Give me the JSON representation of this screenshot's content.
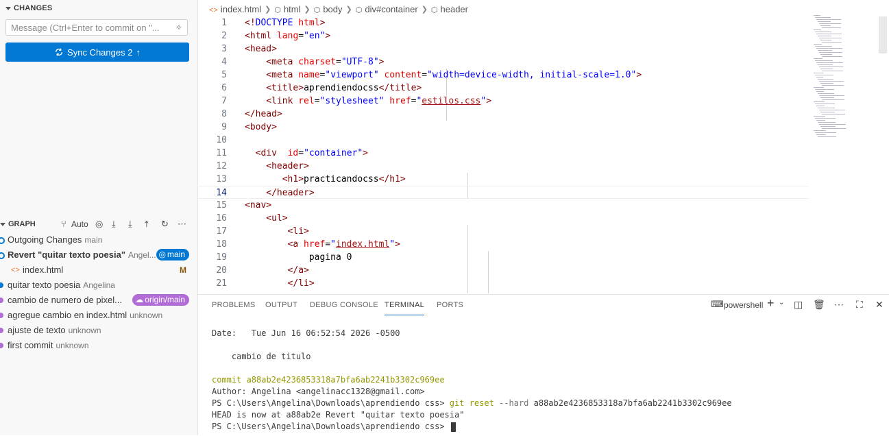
{
  "scm": {
    "changes_title": "CHANGES",
    "message_placeholder": "Message (Ctrl+Enter to commit on \"...",
    "sync_label": "Sync Changes 2",
    "graph_title": "GRAPH",
    "graph_auto_label": "Auto",
    "graph": [
      {
        "text": "Outgoing Changes",
        "author": "main",
        "dot_color": "#0078d4",
        "hollow": true
      },
      {
        "text": "Revert \"quitar texto poesia\"",
        "author": "Angel...",
        "badge": "main",
        "badge_color": "#0078d4",
        "bold": true,
        "dot_color": "#0078d4",
        "hollow": true
      },
      {
        "file": "index.html",
        "status": "M"
      },
      {
        "text": "quitar texto poesia",
        "author": "Angelina",
        "dot_color": "#0078d4"
      },
      {
        "text": "cambio de numero de pixel...",
        "author": "",
        "badge": "origin/main",
        "badge_color": "#b16cd6",
        "dot_color": "#b16cd6"
      },
      {
        "text": "agregue cambio en index.html",
        "author": "unknown",
        "dot_color": "#b16cd6"
      },
      {
        "text": "ajuste de texto",
        "author": "unknown",
        "dot_color": "#b16cd6"
      },
      {
        "text": "first commit",
        "author": "unknown",
        "dot_color": "#b16cd6"
      }
    ]
  },
  "breadcrumbs": [
    "index.html",
    "html",
    "body",
    "div#container",
    "header"
  ],
  "editor": {
    "active_line": 14,
    "lines": [
      {
        "n": 1,
        "indent": 0,
        "tokens": [
          [
            "t-tag",
            "<!"
          ],
          [
            "t-kw",
            "DOCTYPE "
          ],
          [
            "t-attr",
            "html"
          ],
          [
            "t-tag",
            ">"
          ]
        ]
      },
      {
        "n": 2,
        "indent": 0,
        "tokens": [
          [
            "t-tag",
            "<html "
          ],
          [
            "t-attr",
            "lang"
          ],
          [
            "t-txt",
            "="
          ],
          [
            "t-val",
            "\"en\""
          ],
          [
            "t-tag",
            ">"
          ]
        ]
      },
      {
        "n": 3,
        "indent": 0,
        "tokens": [
          [
            "t-tag",
            "<head>"
          ]
        ]
      },
      {
        "n": 4,
        "indent": 4,
        "tokens": [
          [
            "t-tag",
            "<meta "
          ],
          [
            "t-attr",
            "charset"
          ],
          [
            "t-txt",
            "="
          ],
          [
            "t-val",
            "\"UTF-8\""
          ],
          [
            "t-tag",
            ">"
          ]
        ]
      },
      {
        "n": 5,
        "indent": 4,
        "tokens": [
          [
            "t-tag",
            "<meta "
          ],
          [
            "t-attr",
            "name"
          ],
          [
            "t-txt",
            "="
          ],
          [
            "t-val",
            "\"viewport\" "
          ],
          [
            "t-attr",
            "content"
          ],
          [
            "t-txt",
            "="
          ],
          [
            "t-val",
            "\"width=device-width, initial-scale=1.0\""
          ],
          [
            "t-tag",
            ">"
          ]
        ]
      },
      {
        "n": 6,
        "indent": 4,
        "tokens": [
          [
            "t-tag",
            "<title>"
          ],
          [
            "t-txt",
            "aprendiendocss"
          ],
          [
            "t-tag",
            "</title>"
          ]
        ]
      },
      {
        "n": 7,
        "indent": 4,
        "tokens": [
          [
            "t-tag",
            "<link "
          ],
          [
            "t-attr",
            "rel"
          ],
          [
            "t-txt",
            "="
          ],
          [
            "t-val",
            "\"stylesheet\" "
          ],
          [
            "t-attr",
            "href"
          ],
          [
            "t-txt",
            "="
          ],
          [
            "t-val",
            "\""
          ],
          [
            "t-link",
            "estilos.css"
          ],
          [
            "t-val",
            "\""
          ],
          [
            "t-tag",
            ">"
          ]
        ]
      },
      {
        "n": 8,
        "indent": 0,
        "tokens": [
          [
            "t-tag",
            "</head>"
          ]
        ]
      },
      {
        "n": 9,
        "indent": 0,
        "tokens": [
          [
            "t-tag",
            "<body>"
          ]
        ]
      },
      {
        "n": 10,
        "indent": 0,
        "tokens": []
      },
      {
        "n": 11,
        "indent": 2,
        "tokens": [
          [
            "t-tag",
            "<div  "
          ],
          [
            "t-attr",
            "id"
          ],
          [
            "t-txt",
            "="
          ],
          [
            "t-val",
            "\"container\""
          ],
          [
            "t-tag",
            ">"
          ]
        ]
      },
      {
        "n": 12,
        "indent": 4,
        "tokens": [
          [
            "t-tag",
            "<header>"
          ]
        ]
      },
      {
        "n": 13,
        "indent": 7,
        "tokens": [
          [
            "t-tag",
            "<h1>"
          ],
          [
            "t-txt",
            "practicandocss"
          ],
          [
            "t-tag",
            "</h1>"
          ]
        ]
      },
      {
        "n": 14,
        "indent": 4,
        "tokens": [
          [
            "t-tag",
            "</header>"
          ]
        ]
      },
      {
        "n": 15,
        "indent": 0,
        "tokens": [
          [
            "t-tag",
            "<nav>"
          ]
        ]
      },
      {
        "n": 16,
        "indent": 4,
        "tokens": [
          [
            "t-tag",
            "<ul>"
          ]
        ]
      },
      {
        "n": 17,
        "indent": 8,
        "tokens": [
          [
            "t-tag",
            "<li>"
          ]
        ]
      },
      {
        "n": 18,
        "indent": 8,
        "tokens": [
          [
            "t-tag",
            "<a "
          ],
          [
            "t-attr",
            "href"
          ],
          [
            "t-txt",
            "="
          ],
          [
            "t-val",
            "\""
          ],
          [
            "t-link",
            "index.html"
          ],
          [
            "t-val",
            "\""
          ],
          [
            "t-tag",
            ">"
          ]
        ]
      },
      {
        "n": 19,
        "indent": 12,
        "tokens": [
          [
            "t-txt",
            "pagina 0"
          ]
        ]
      },
      {
        "n": 20,
        "indent": 8,
        "tokens": [
          [
            "t-tag",
            "</a>"
          ]
        ]
      },
      {
        "n": 21,
        "indent": 8,
        "tokens": [
          [
            "t-tag",
            "</li>"
          ]
        ]
      }
    ]
  },
  "panel": {
    "tabs": [
      "PROBLEMS",
      "OUTPUT",
      "DEBUG CONSOLE",
      "TERMINAL",
      "PORTS"
    ],
    "active_tab": "TERMINAL",
    "shell_label": "powershell"
  },
  "terminal": [
    {
      "segments": [
        [
          "",
          "Date:   Tue Jun 16 06:52:54 2026 -0500"
        ]
      ]
    },
    {
      "segments": [
        [
          "",
          ""
        ]
      ]
    },
    {
      "segments": [
        [
          "",
          "    cambio de titulo"
        ]
      ]
    },
    {
      "segments": [
        [
          "",
          ""
        ]
      ]
    },
    {
      "segments": [
        [
          "y",
          "commit a88ab2e4236853318a7bfa6ab2241b3302c969ee"
        ]
      ]
    },
    {
      "segments": [
        [
          "",
          "Author: Angelina <angelinacc1328@gmail.com>"
        ]
      ]
    },
    {
      "segments": [
        [
          "",
          "PS C:\\Users\\Angelina\\Downloads\\aprendiendo css> "
        ],
        [
          "y",
          "git "
        ],
        [
          "y",
          "reset "
        ],
        [
          "gr",
          "--hard "
        ],
        [
          "",
          "a88ab2e4236853318a7bfa6ab2241b3302c969ee"
        ]
      ]
    },
    {
      "segments": [
        [
          "",
          "HEAD is now at a88ab2e Revert \"quitar texto poesia\""
        ]
      ]
    },
    {
      "segments": [
        [
          "",
          "PS C:\\Users\\Angelina\\Downloads\\aprendiendo css> "
        ]
      ],
      "cursor": true
    }
  ]
}
